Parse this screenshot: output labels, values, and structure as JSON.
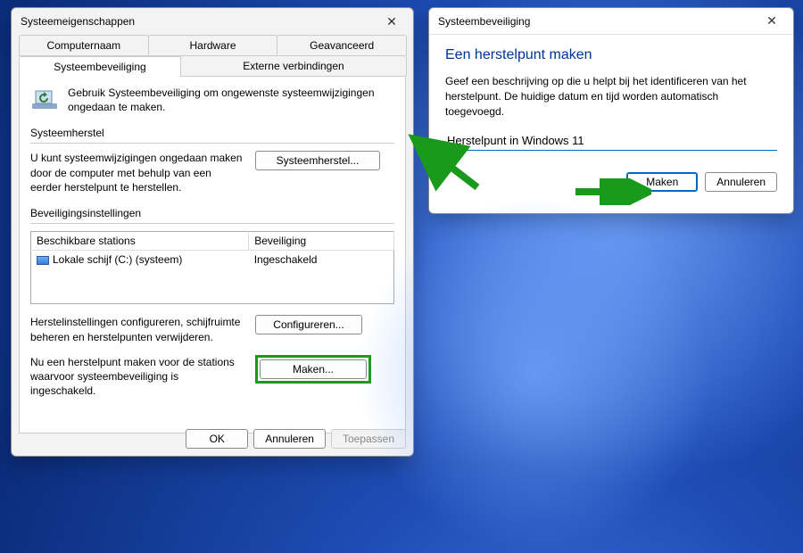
{
  "props": {
    "title": "Systeemeigenschappen",
    "tabs_row1": [
      "Computernaam",
      "Hardware",
      "Geavanceerd"
    ],
    "tabs_row2": [
      "Systeembeveiliging",
      "Externe verbindingen"
    ],
    "active_tab": "Systeembeveiliging",
    "info_text": "Gebruik Systeembeveiliging om ongewenste systeemwijzigingen ongedaan te maken.",
    "restore": {
      "label": "Systeemherstel",
      "text": "U kunt systeemwijzigingen ongedaan maken door de computer met behulp van een eerder herstelpunt te herstellen.",
      "button": "Systeemherstel..."
    },
    "protection": {
      "label": "Beveiligingsinstellingen",
      "columns": [
        "Beschikbare stations",
        "Beveiliging"
      ],
      "rows": [
        {
          "drive": "Lokale schijf (C:) (systeem)",
          "status": "Ingeschakeld"
        }
      ],
      "config_text": "Herstelinstellingen configureren, schijfruimte beheren en herstelpunten verwijderen.",
      "config_button": "Configureren...",
      "create_text": "Nu een herstelpunt maken voor de stations waarvoor systeembeveiliging is ingeschakeld.",
      "create_button": "Maken..."
    },
    "buttons": {
      "ok": "OK",
      "cancel": "Annuleren",
      "apply": "Toepassen"
    }
  },
  "create": {
    "title": "Systeembeveiliging",
    "heading": "Een herstelpunt maken",
    "sub": "Geef een beschrijving op die u helpt bij het identificeren van het herstelpunt. De huidige datum en tijd worden automatisch toegevoegd.",
    "input_value": "Herstelpunt in Windows 11",
    "buttons": {
      "make": "Maken",
      "cancel": "Annuleren"
    }
  },
  "colors": {
    "highlight": "#1a9a1a",
    "link_blue": "#003399",
    "accent": "#0067c0"
  }
}
